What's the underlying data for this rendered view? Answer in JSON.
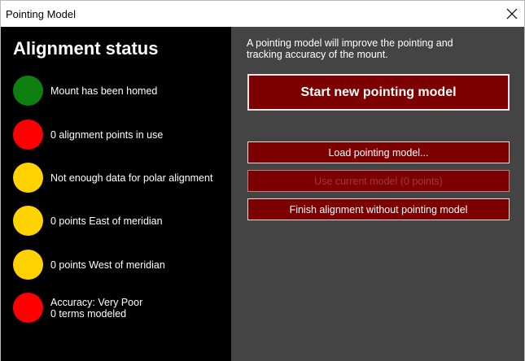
{
  "window": {
    "title": "Pointing Model",
    "close_glyph": "✕"
  },
  "status": {
    "heading": "Alignment status",
    "items": [
      {
        "color": "#0e7f0e",
        "label": "Mount has been homed"
      },
      {
        "color": "#ff0000",
        "label": "0 alignment points in use"
      },
      {
        "color": "#ffd200",
        "label": "Not enough data for polar alignment"
      },
      {
        "color": "#ffd200",
        "label": "0 points East of meridian"
      },
      {
        "color": "#ffd200",
        "label": "0 points West of meridian"
      },
      {
        "color": "#ff0000",
        "label": "Accuracy: Very Poor\n0 terms modeled"
      }
    ]
  },
  "panel": {
    "intro": "A pointing model will improve the pointing and\ntracking accuracy of the mount.",
    "start_label": "Start new pointing model",
    "load_label": "Load pointing model...",
    "use_current_label": "Use current model (0 points)",
    "finish_label": "Finish alignment without pointing model"
  },
  "colors": {
    "button_bg": "#7d0000",
    "left_bg": "#000000",
    "right_bg": "#444444"
  }
}
